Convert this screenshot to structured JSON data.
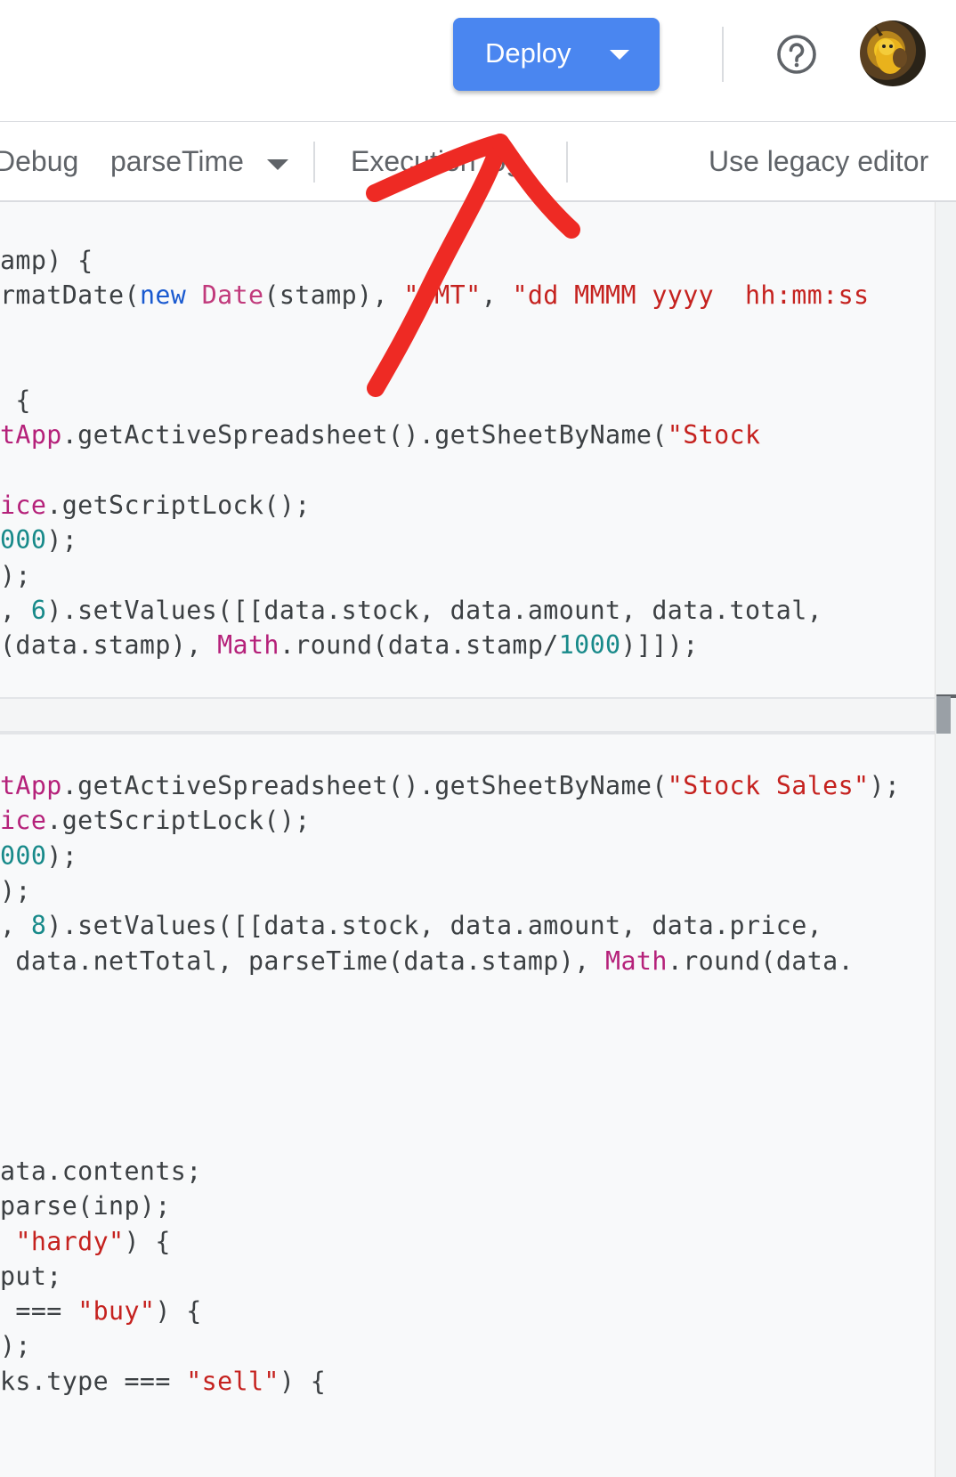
{
  "header": {
    "deploy_label": "Deploy",
    "icons": [
      "help-icon",
      "avatar"
    ]
  },
  "toolbar": {
    "debug_label": "Debug",
    "function_name": "parseTime",
    "execution_log_label": "Execution log",
    "legacy_label": "Use legacy editor"
  },
  "code": {
    "l1": {
      "a": "amp) {"
    },
    "l2": {
      "a": "rmatDate(",
      "b": "new",
      "c": " ",
      "d": "Date",
      "e": "(stamp), ",
      "f": "\"GMT\"",
      "g": ", ",
      "h": "\"dd MMMM yyyy  hh:mm:ss"
    },
    "l3": {
      "a": " {"
    },
    "l4": {
      "a": "tApp",
      "b": ".getActiveSpreadsheet().getSheetByName(",
      "c": "\"Stock"
    },
    "l5": {
      "a": "ice",
      "b": ".getScriptLock();"
    },
    "l6": {
      "a": "000",
      "b": ");"
    },
    "l7": {
      "a": ");"
    },
    "l8": {
      "a": ", ",
      "b": "6",
      "c": ").setValues([[data.stock, data.amount, data.total,"
    },
    "l9": {
      "a": "(data.stamp), ",
      "b": "Math",
      "c": ".round(data.stamp/",
      "d": "1000",
      "e": ")]]);"
    },
    "l10": {
      "a": "tApp",
      "b": ".getActiveSpreadsheet().getSheetByName(",
      "c": "\"Stock Sales\"",
      "d": ");"
    },
    "l11": {
      "a": "ice",
      "b": ".getScriptLock();"
    },
    "l12": {
      "a": "000",
      "b": ");"
    },
    "l13": {
      "a": ");"
    },
    "l14": {
      "a": ", ",
      "b": "8",
      "c": ").setValues([[data.stock, data.amount, data.price,"
    },
    "l15": {
      "a": " data.netTotal, parseTime(data.stamp), ",
      "b": "Math",
      "c": ".round(data."
    },
    "l16": {
      "a": "ata.contents;"
    },
    "l17": {
      "a": "parse(inp);"
    },
    "l18": {
      "a": " ",
      "b": "\"hardy\"",
      "c": ") {"
    },
    "l19": {
      "a": "put;"
    },
    "l20": {
      "a": " === ",
      "b": "\"buy\"",
      "c": ") {"
    },
    "l21": {
      "a": ");"
    },
    "l22": {
      "a": "ks.type === ",
      "b": "\"sell\"",
      "c": ") {"
    }
  },
  "colors": {
    "deploy_button": "#4a86f0",
    "annotation_arrow": "#ee2a24",
    "string": "#c5221f",
    "keyword": "#1a5ad0",
    "number": "#188a8a",
    "class": "#c13a7c"
  }
}
